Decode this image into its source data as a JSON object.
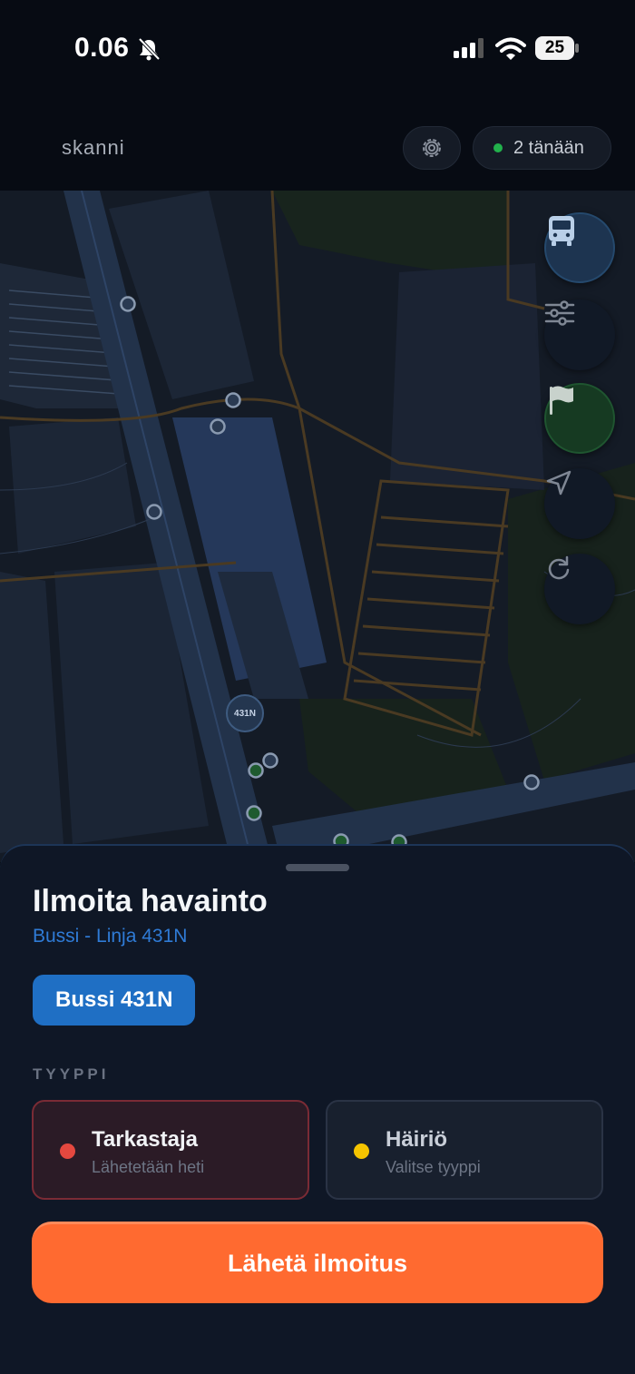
{
  "status_bar": {
    "time": "0.06",
    "battery": "25"
  },
  "header": {
    "logo": "skanni",
    "today_text": "2 tänään",
    "today_dot_color": "#22b14c"
  },
  "map": {
    "vehicle_label": "431N",
    "controls": [
      "bus-icon",
      "sliders-icon",
      "flag-icon",
      "navigation-arrow-icon",
      "refresh-icon"
    ]
  },
  "sheet": {
    "title": "Ilmoita havainto",
    "subtitle": "Bussi - Linja 431N",
    "vehicle_chip": "Bussi 431N",
    "type_heading": "TYYPPI",
    "types": [
      {
        "title": "Tarkastaja",
        "desc": "Lähetetään heti",
        "color": "#e5483f",
        "selected": true
      },
      {
        "title": "Häiriö",
        "desc": "Valitse tyyppi",
        "color": "#f5c400",
        "selected": false
      }
    ],
    "submit_label": "Lähetä ilmoitus",
    "accent_color": "#ff6a30"
  }
}
